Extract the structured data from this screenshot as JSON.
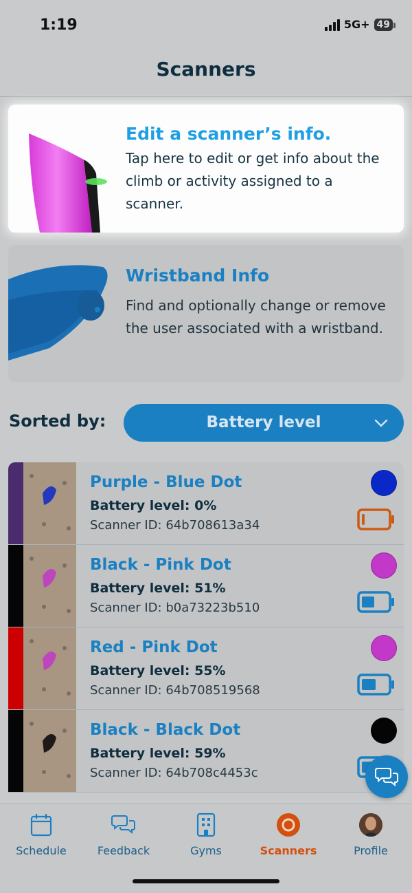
{
  "status_bar": {
    "time": "1:19",
    "network": "5G+",
    "battery": "49"
  },
  "header": {
    "title": "Scanners"
  },
  "cards": {
    "edit": {
      "title": "Edit a scanner’s info.",
      "text": "Tap here to edit or get info about the climb or activity assigned to a scanner."
    },
    "wristband": {
      "title": "Wristband Info",
      "text": "Find and optionally change or remove the user associated with a wristband."
    }
  },
  "sort": {
    "label": "Sorted by:",
    "value": "Battery level"
  },
  "scanners": [
    {
      "name": "Purple - Blue Dot",
      "battery_text": "Battery level: 0%",
      "battery_pct": 0,
      "scanner_id": "Scanner ID: 64b708613a34",
      "stripe_color": "#4a2c6e",
      "dot_color": "#0a28c8",
      "battery_icon_color": "#cc5a14"
    },
    {
      "name": "Black - Pink Dot",
      "battery_text": "Battery level: 51%",
      "battery_pct": 51,
      "scanner_id": "Scanner ID: b0a73223b510",
      "stripe_color": "#050505",
      "dot_color": "#c238c8",
      "battery_icon_color": "#1b80c2"
    },
    {
      "name": "Red - Pink Dot",
      "battery_text": "Battery level: 55%",
      "battery_pct": 55,
      "scanner_id": "Scanner ID: 64b708519568",
      "stripe_color": "#cc0000",
      "dot_color": "#c238c8",
      "battery_icon_color": "#1b80c2"
    },
    {
      "name": "Black - Black Dot",
      "battery_text": "Battery level: 59%",
      "battery_pct": 59,
      "scanner_id": "Scanner ID: 64b708c4453c",
      "stripe_color": "#050505",
      "dot_color": "#050505",
      "battery_icon_color": "#1b80c2"
    }
  ],
  "tabs": [
    {
      "label": "Schedule",
      "icon": "calendar-icon",
      "active": false
    },
    {
      "label": "Feedback",
      "icon": "chat-bubbles-icon",
      "active": false
    },
    {
      "label": "Gyms",
      "icon": "building-icon",
      "active": false
    },
    {
      "label": "Scanners",
      "icon": "scanner-icon",
      "active": true
    },
    {
      "label": "Profile",
      "icon": "avatar",
      "active": false
    }
  ],
  "colors": {
    "primary": "#1b80c2",
    "accent_active": "#d4500f",
    "title_dark": "#0f2e3f",
    "edit_title": "#1f9fe3"
  }
}
